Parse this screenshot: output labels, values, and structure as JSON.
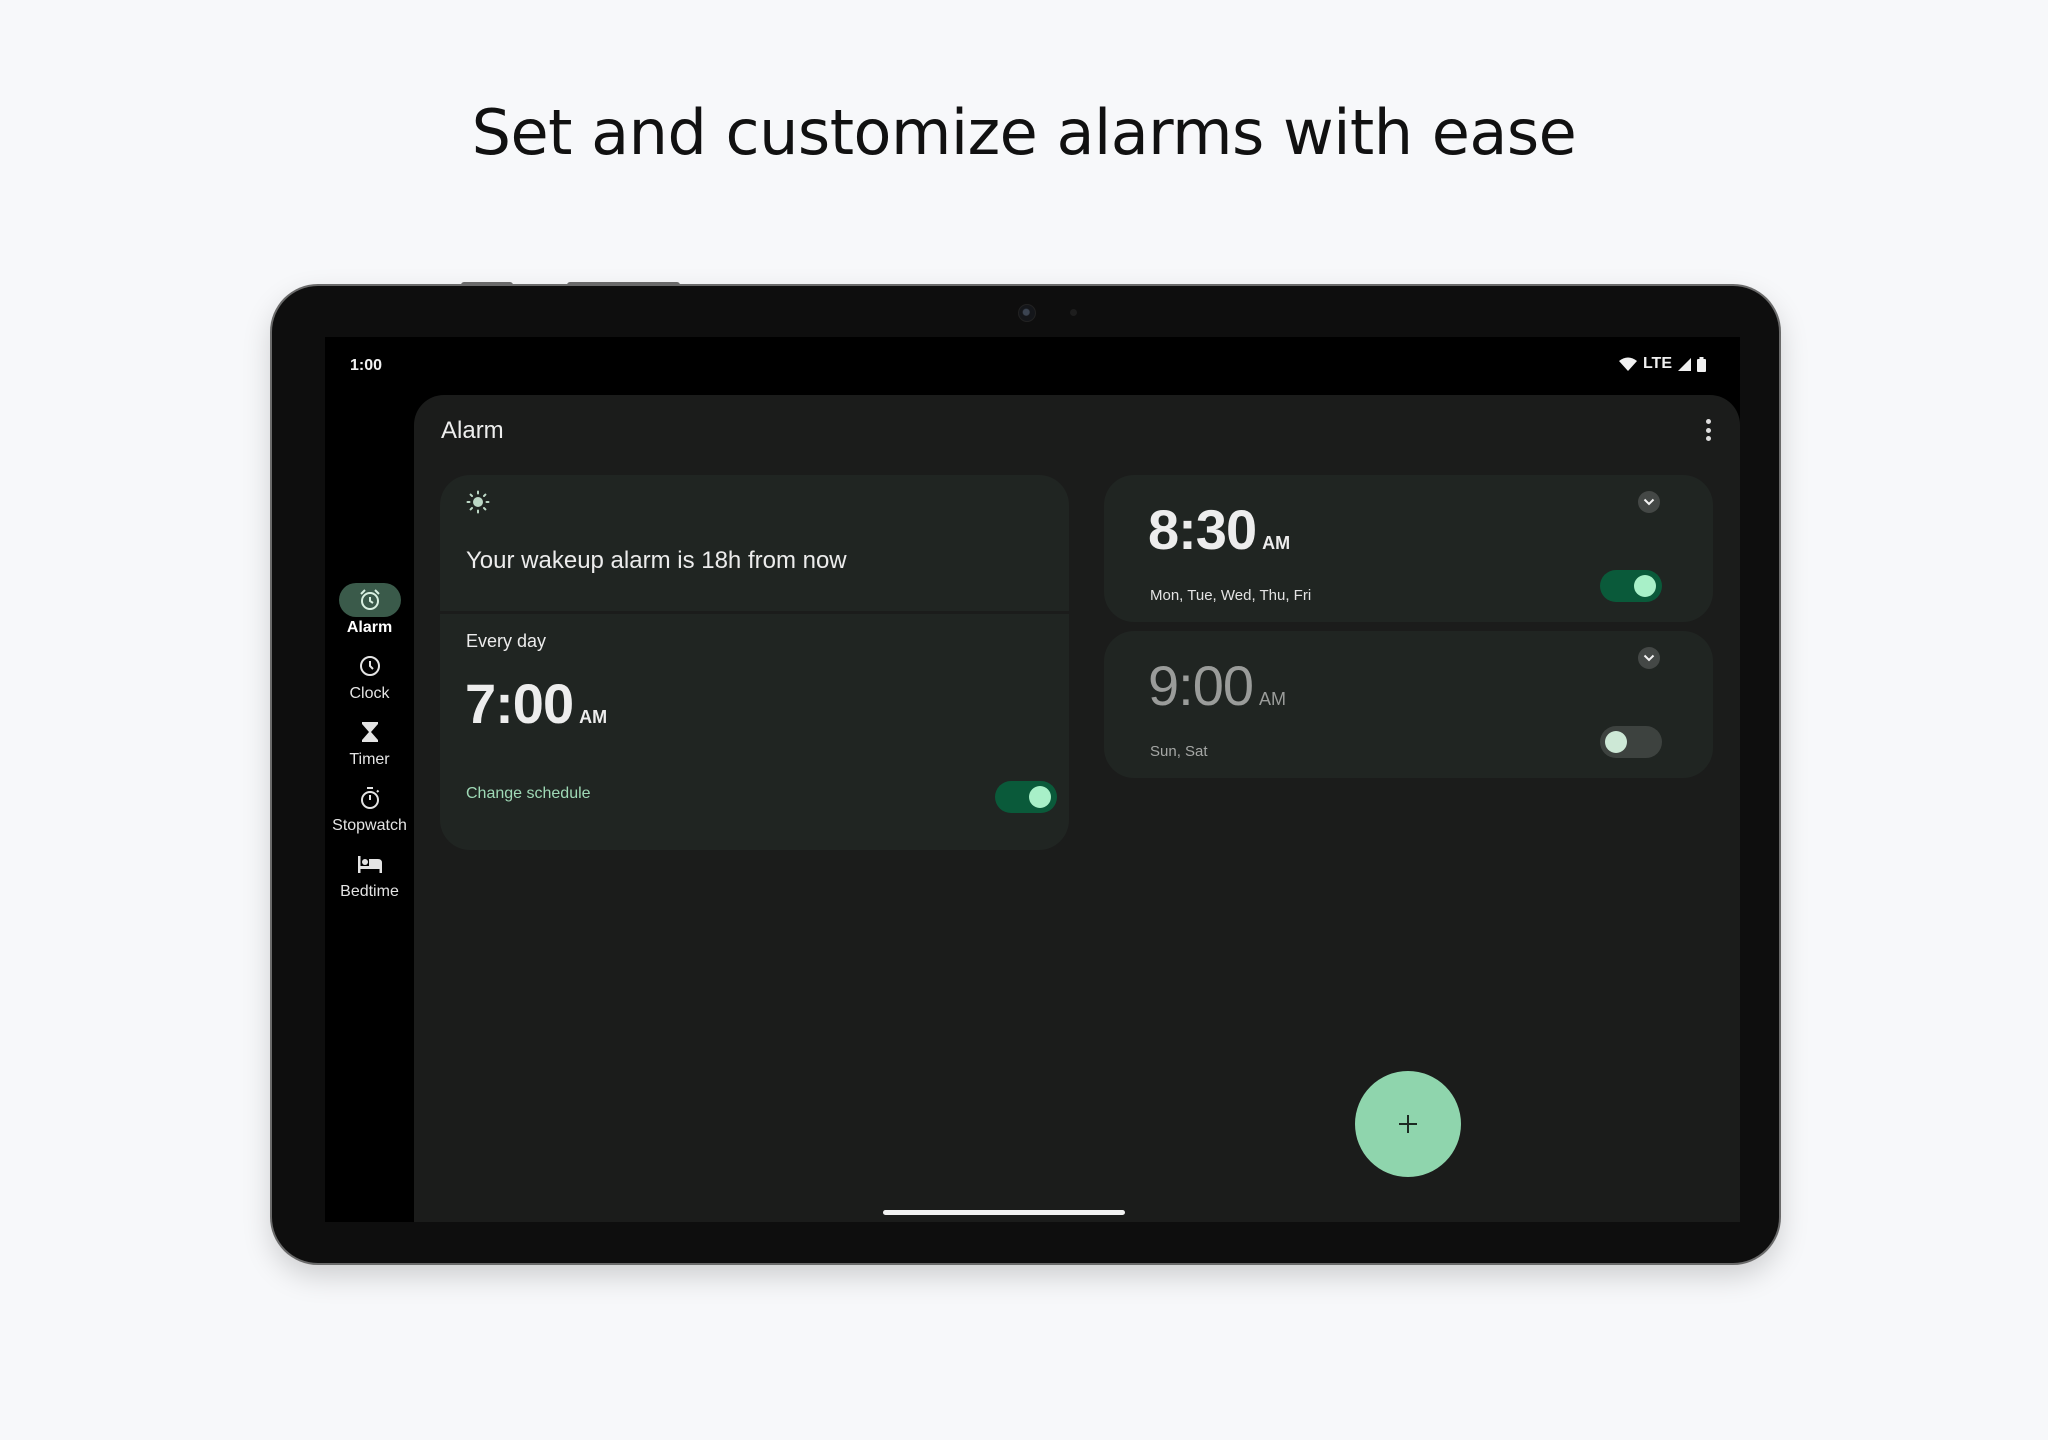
{
  "headline": "Set and customize alarms with ease",
  "status_bar": {
    "time": "1:00",
    "network": "LTE",
    "icons": [
      "wifi-icon",
      "signal-icon",
      "battery-icon"
    ]
  },
  "nav": {
    "items": [
      {
        "label": "Alarm",
        "icon": "alarm-icon",
        "active": true
      },
      {
        "label": "Clock",
        "icon": "clock-icon",
        "active": false
      },
      {
        "label": "Timer",
        "icon": "hourglass-icon",
        "active": false
      },
      {
        "label": "Stopwatch",
        "icon": "stopwatch-icon",
        "active": false
      },
      {
        "label": "Bedtime",
        "icon": "bed-icon",
        "active": false
      }
    ]
  },
  "header": {
    "title": "Alarm",
    "more_icon": "more-vert-icon"
  },
  "wakeup_card": {
    "icon": "sun-icon",
    "message": "Your wakeup alarm is 18h from now",
    "schedule": "Every day",
    "time": "7:00",
    "ampm": "AM",
    "change_schedule_label": "Change schedule",
    "enabled": true
  },
  "alarms": [
    {
      "time": "8:30",
      "ampm": "AM",
      "days": "Mon, Tue, Wed, Thu, Fri",
      "enabled": true
    },
    {
      "time": "9:00",
      "ampm": "AM",
      "days": "Sun, Sat",
      "enabled": false
    }
  ],
  "fab": {
    "label": "+",
    "icon": "add-icon"
  },
  "colors": {
    "accent": "#8fd5ad",
    "toggle_on_track": "#0a5a3a",
    "toggle_on_knob": "#a8f0c8",
    "card_bg": "#202522",
    "panel_bg": "#1b1c1b",
    "nav_active_pill": "#3a5a4a",
    "link": "#9fd9b6"
  }
}
